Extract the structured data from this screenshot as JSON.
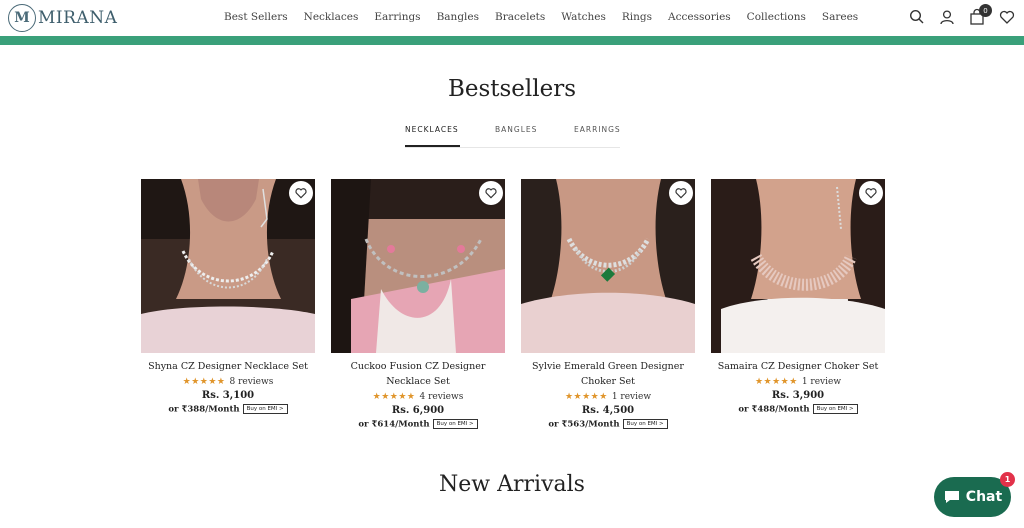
{
  "brand": {
    "logo_letter": "M",
    "name": "MIRANA"
  },
  "nav": [
    "Best Sellers",
    "Necklaces",
    "Earrings",
    "Bangles",
    "Bracelets",
    "Watches",
    "Rings",
    "Accessories",
    "Collections",
    "Sarees"
  ],
  "cart": {
    "count": "0"
  },
  "announcement_bar": {
    "color": "#3aa07a"
  },
  "bestsellers": {
    "title": "Bestsellers",
    "tabs": [
      "NECKLACES",
      "BANGLES",
      "EARRINGS"
    ],
    "active_tab": "NECKLACES"
  },
  "products": [
    {
      "name": "Shyna CZ Designer Necklace Set",
      "stars": "★★★★★",
      "reviews": "8 reviews",
      "price": "Rs. 3,100",
      "emi": "or ₹388/Month",
      "emi_button": "Buy on EMI >"
    },
    {
      "name": "Cuckoo Fusion CZ Designer Necklace Set",
      "stars": "★★★★★",
      "reviews": "4 reviews",
      "price": "Rs. 6,900",
      "emi": "or ₹614/Month",
      "emi_button": "Buy on EMI >"
    },
    {
      "name": "Sylvie Emerald Green Designer Choker Set",
      "stars": "★★★★★",
      "reviews": "1 review",
      "price": "Rs. 4,500",
      "emi": "or ₹563/Month",
      "emi_button": "Buy on EMI >"
    },
    {
      "name": "Samaira CZ Designer Choker Set",
      "stars": "★★★★★",
      "reviews": "1 review",
      "price": "Rs. 3,900",
      "emi": "or ₹488/Month",
      "emi_button": "Buy on EMI >"
    }
  ],
  "new_arrivals": {
    "title": "New Arrivals"
  },
  "chat": {
    "label": "Chat",
    "badge": "1"
  },
  "icons": [
    "search-icon",
    "account-icon",
    "cart-icon",
    "wishlist-icon",
    "heart-icon",
    "chat-bubble-icon"
  ]
}
